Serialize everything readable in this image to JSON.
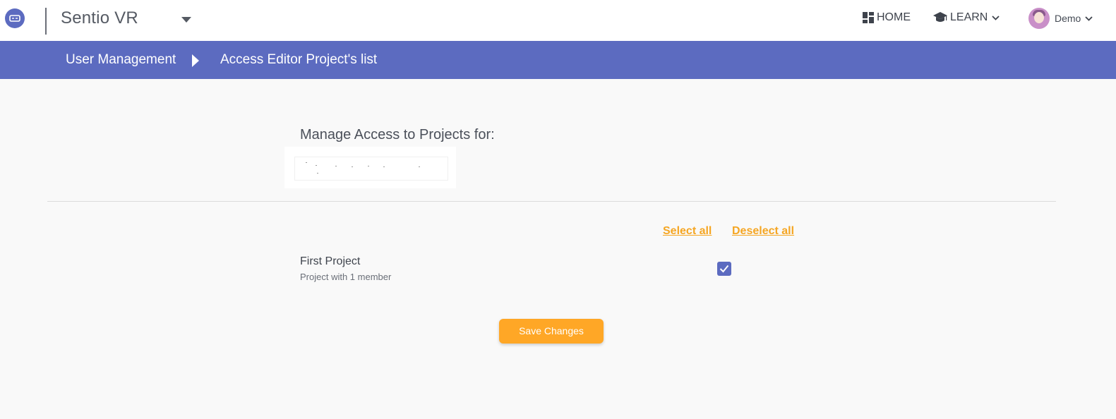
{
  "app": {
    "title": "Sentio VR"
  },
  "nav": {
    "home_label": "HOME",
    "learn_label": "LEARN",
    "user_name": "Demo"
  },
  "breadcrumb": {
    "items": [
      "User Management",
      "Access Editor Project's list"
    ]
  },
  "main": {
    "heading": "Manage Access to Projects for:",
    "select_all": "Select all",
    "deselect_all": "Deselect all",
    "projects": [
      {
        "name": "First Project",
        "subtitle": "Project with 1 member",
        "checked": true
      }
    ],
    "save_label": "Save Changes"
  },
  "colors": {
    "primary": "#5c6bc0",
    "accent": "#ffa726",
    "link": "#f5a623"
  },
  "icons": {
    "logo": "vr-headset-icon",
    "app_dropdown": "caret-down-icon",
    "home": "dashboard-grid-icon",
    "learn": "graduation-cap-icon",
    "user": "avatar",
    "breadcrumb_separator": "caret-right-icon",
    "checkbox": "check-icon"
  }
}
